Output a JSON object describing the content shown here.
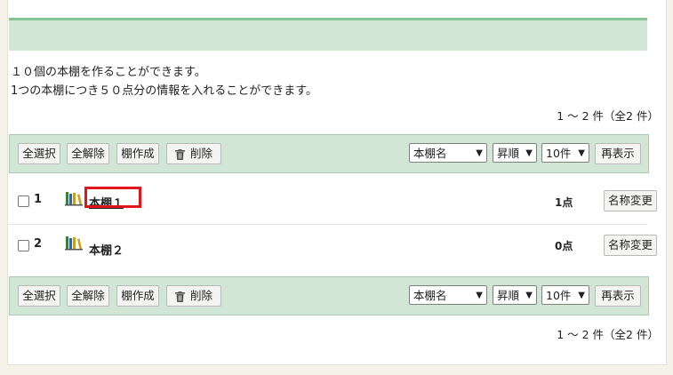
{
  "info": {
    "line1": "１０個の本棚を作ることができます。",
    "line2": "1つの本棚につき５０点分の情報を入れることができます。"
  },
  "count_text": "1 ～ 2 件（全2 件）",
  "toolbar": {
    "select_all": "全選択",
    "deselect_all": "全解除",
    "create_shelf": "棚作成",
    "delete": "削除",
    "sort_field": "本棚名",
    "sort_order": "昇順",
    "per_page": "10件",
    "redisplay": "再表示"
  },
  "shelves": [
    {
      "num": "1",
      "name": "本棚１",
      "points": "1点",
      "rename": "名称変更"
    },
    {
      "num": "2",
      "name": "本棚２",
      "points": "0点",
      "rename": "名称変更"
    }
  ],
  "colors": {
    "accent_green": "#86c491",
    "bar_green": "#d2e6d6",
    "highlight_red": "#e0161c"
  }
}
